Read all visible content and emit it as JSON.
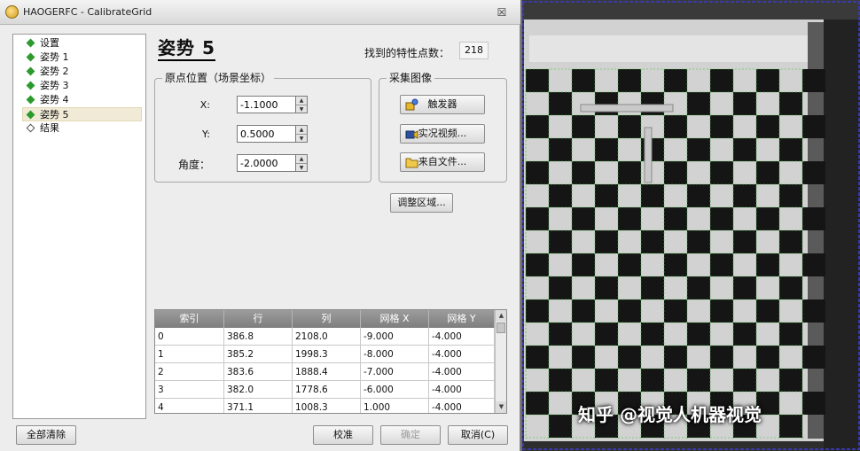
{
  "window": {
    "title": "HAOGERFC - CalibrateGrid",
    "close_glyph": "☒"
  },
  "tree": {
    "items": [
      {
        "label": "设置",
        "active": true
      },
      {
        "label": "姿势 1",
        "active": true
      },
      {
        "label": "姿势 2",
        "active": true
      },
      {
        "label": "姿势 3",
        "active": true
      },
      {
        "label": "姿势 4",
        "active": true
      },
      {
        "label": "姿势 5",
        "active": true,
        "selected": true
      },
      {
        "label": "结果",
        "active": false
      }
    ]
  },
  "header": {
    "title": "姿势 5",
    "features_label": "找到的特性点数：",
    "features_value": "218"
  },
  "origin": {
    "title": "原点位置（场景坐标）",
    "x_label": "X:",
    "x_value": "-1.1000",
    "y_label": "Y:",
    "y_value": "0.5000",
    "angle_label": "角度：",
    "angle_value": "-2.0000"
  },
  "capture": {
    "title": "采集图像",
    "trigger": "触发器",
    "live_video": "实况视频...",
    "from_file": "来自文件..."
  },
  "adjust_region": "调整区域...",
  "table": {
    "columns": [
      "索引",
      "行",
      "列",
      "网格 X",
      "网格 Y"
    ],
    "rows": [
      [
        "0",
        "386.8",
        "2108.0",
        "-9.000",
        "-4.000"
      ],
      [
        "1",
        "385.2",
        "1998.3",
        "-8.000",
        "-4.000"
      ],
      [
        "2",
        "383.6",
        "1888.4",
        "-7.000",
        "-4.000"
      ],
      [
        "3",
        "382.0",
        "1778.6",
        "-6.000",
        "-4.000"
      ],
      [
        "4",
        "371.1",
        "1008.3",
        "1.000",
        "-4.000"
      ]
    ]
  },
  "footer": {
    "clear_all": "全部清除",
    "calibrate": "校准",
    "ok": "确定",
    "cancel": "取消(C)"
  },
  "watermark": "知乎 @视觉人机器视觉",
  "colors": {
    "tree_bullet": "#2c9a2c",
    "selection": "#f1ead7",
    "grid_line": "#35c235",
    "header_row": "#8c8c8c"
  }
}
